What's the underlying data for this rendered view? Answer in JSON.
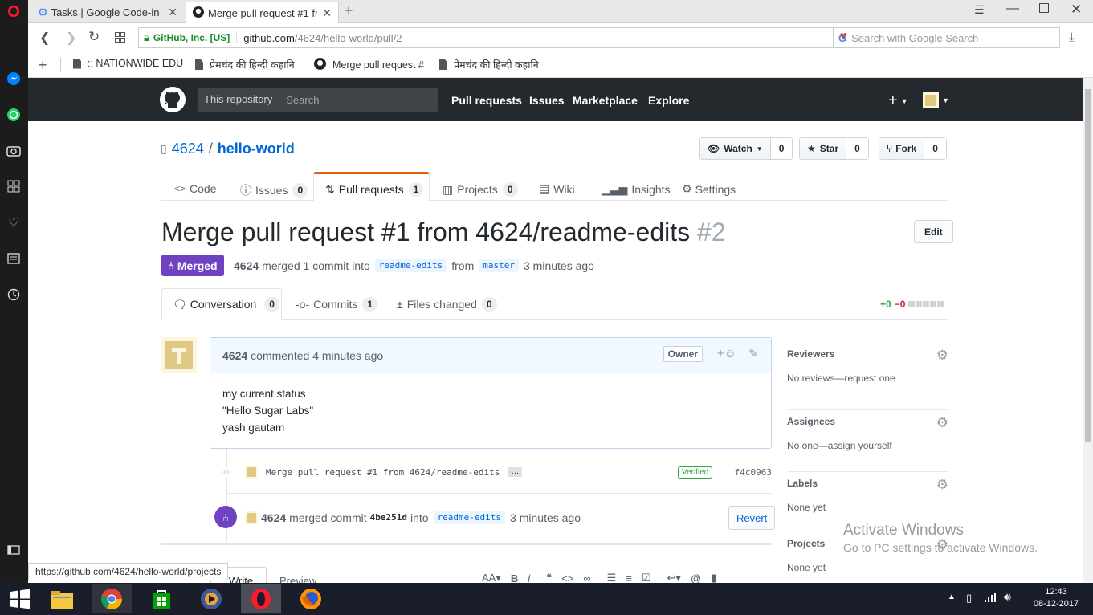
{
  "browser": {
    "tabs": [
      {
        "title": "Tasks | Google Code-in"
      },
      {
        "title": "Merge pull request #1 from"
      }
    ],
    "new_tab": "+",
    "address": {
      "secure_label": "GitHub, Inc. [US]",
      "url_host": "github.com",
      "url_path": "/4624/hello-world/pull/2"
    },
    "search_placeholder": "Search with Google Search",
    "bookmarks": [
      {
        "label": ":: NATIONWIDE EDU"
      },
      {
        "label": "प्रेमचंद की हिन्दी कहानि"
      },
      {
        "label": "Merge pull request #"
      },
      {
        "label": "प्रेमचंद की हिन्दी कहानि"
      }
    ],
    "status_url": "https://github.com/4624/hello-world/projects"
  },
  "github": {
    "scope": "This repository",
    "search_placeholder": "Search",
    "nav": [
      "Pull requests",
      "Issues",
      "Marketplace",
      "Explore"
    ],
    "plus": "+",
    "repo": {
      "owner": "4624",
      "separator": "/",
      "name": "hello-world"
    },
    "actions": {
      "watch": {
        "label": "Watch",
        "count": "0"
      },
      "star": {
        "label": "Star",
        "count": "0"
      },
      "fork": {
        "label": "Fork",
        "count": "0"
      }
    },
    "repo_tabs": {
      "code": {
        "label": "Code"
      },
      "issues": {
        "label": "Issues",
        "count": "0"
      },
      "pulls": {
        "label": "Pull requests",
        "count": "1"
      },
      "projects": {
        "label": "Projects",
        "count": "0"
      },
      "wiki": {
        "label": "Wiki"
      },
      "insights": {
        "label": "Insights"
      },
      "settings": {
        "label": "Settings"
      }
    },
    "pr": {
      "title": "Merge pull request #1 from 4624/readme-edits",
      "number": "#2",
      "edit_label": "Edit",
      "state": "Merged",
      "author": "4624",
      "merged_text": "merged 1 commit into",
      "base_branch": "readme-edits",
      "from_text": "from",
      "head_branch": "master",
      "time": "3 minutes ago"
    },
    "pr_tabs": {
      "conversation": {
        "label": "Conversation",
        "count": "0"
      },
      "commits": {
        "label": "Commits",
        "count": "1"
      },
      "files": {
        "label": "Files changed",
        "count": "0"
      }
    },
    "diffstat": {
      "added": "+0",
      "removed": "−0"
    },
    "comment": {
      "author": "4624",
      "meta": "commented 4 minutes ago",
      "badge": "Owner",
      "lines": [
        "my current status",
        "\"Hello Sugar Labs\"",
        "yash gautam"
      ]
    },
    "commit": {
      "message": "Merge pull request #1 from 4624/readme-edits",
      "ellipsis": "…",
      "verified": "Verified",
      "sha": "f4c0963"
    },
    "merge_event": {
      "author": "4624",
      "text": "merged commit",
      "sha": "4be251d",
      "into": "into",
      "branch": "readme-edits",
      "time": "3 minutes ago",
      "revert": "Revert"
    },
    "editor": {
      "write": "Write",
      "preview": "Preview"
    },
    "sidebar": {
      "reviewers": {
        "title": "Reviewers",
        "value": "No reviews—request one"
      },
      "assignees": {
        "title": "Assignees",
        "value": "No one—assign yourself"
      },
      "labels": {
        "title": "Labels",
        "value": "None yet"
      },
      "projects": {
        "title": "Projects",
        "value": "None yet"
      }
    }
  },
  "watermark": {
    "title": "Activate Windows",
    "subtitle": "Go to PC settings to activate Windows."
  },
  "taskbar": {
    "time": "12:43",
    "date": "08-12-2017"
  },
  "colors": {
    "merged": "#6f42c1",
    "header": "#24292e",
    "accent": "#e36209",
    "link": "#0366d6"
  }
}
